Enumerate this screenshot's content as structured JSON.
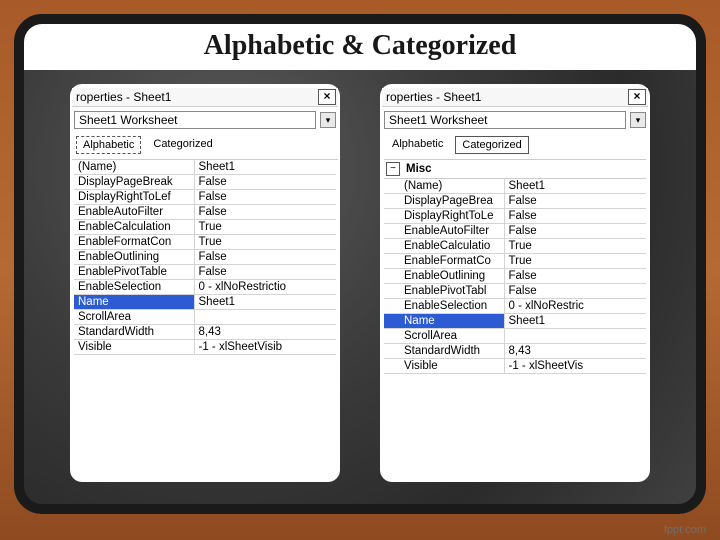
{
  "slide": {
    "title": "Alphabetic & Categorized",
    "footer": "fppt.com"
  },
  "left": {
    "window_title": "roperties - Sheet1",
    "close_glyph": "×",
    "object_selector": "Sheet1 Worksheet",
    "tabs": {
      "alphabetic": "Alphabetic",
      "categorized": "Categorized",
      "active": "alphabetic"
    },
    "rows": [
      {
        "k": "(Name)",
        "v": "Sheet1"
      },
      {
        "k": "DisplayPageBreak",
        "v": "False"
      },
      {
        "k": "DisplayRightToLef",
        "v": "False"
      },
      {
        "k": "EnableAutoFilter",
        "v": "False"
      },
      {
        "k": "EnableCalculation",
        "v": "True"
      },
      {
        "k": "EnableFormatCon",
        "v": "True"
      },
      {
        "k": "EnableOutlining",
        "v": "False"
      },
      {
        "k": "EnablePivotTable",
        "v": "False"
      },
      {
        "k": "EnableSelection",
        "v": "0 - xlNoRestrictio"
      },
      {
        "k": "Name",
        "v": "Sheet1",
        "selected": true
      },
      {
        "k": "ScrollArea",
        "v": ""
      },
      {
        "k": "StandardWidth",
        "v": "8,43"
      },
      {
        "k": "Visible",
        "v": "-1 - xlSheetVisib"
      }
    ]
  },
  "right": {
    "window_title": "roperties - Sheet1",
    "close_glyph": "×",
    "object_selector": "Sheet1 Worksheet",
    "tabs": {
      "alphabetic": "Alphabetic",
      "categorized": "Categorized",
      "active": "categorized"
    },
    "category": {
      "toggle_glyph": "−",
      "label": "Misc"
    },
    "rows": [
      {
        "k": "(Name)",
        "v": "Sheet1"
      },
      {
        "k": "DisplayPageBrea",
        "v": "False"
      },
      {
        "k": "DisplayRightToLe",
        "v": "False"
      },
      {
        "k": "EnableAutoFilter",
        "v": "False"
      },
      {
        "k": "EnableCalculatio",
        "v": "True"
      },
      {
        "k": "EnableFormatCo",
        "v": "True"
      },
      {
        "k": "EnableOutlining",
        "v": "False"
      },
      {
        "k": "EnablePivotTabl",
        "v": "False"
      },
      {
        "k": "EnableSelection",
        "v": "0 - xlNoRestric"
      },
      {
        "k": "Name",
        "v": "Sheet1",
        "selected": true
      },
      {
        "k": "ScrollArea",
        "v": ""
      },
      {
        "k": "StandardWidth",
        "v": "8,43"
      },
      {
        "k": "Visible",
        "v": "-1 - xlSheetVis"
      }
    ]
  }
}
